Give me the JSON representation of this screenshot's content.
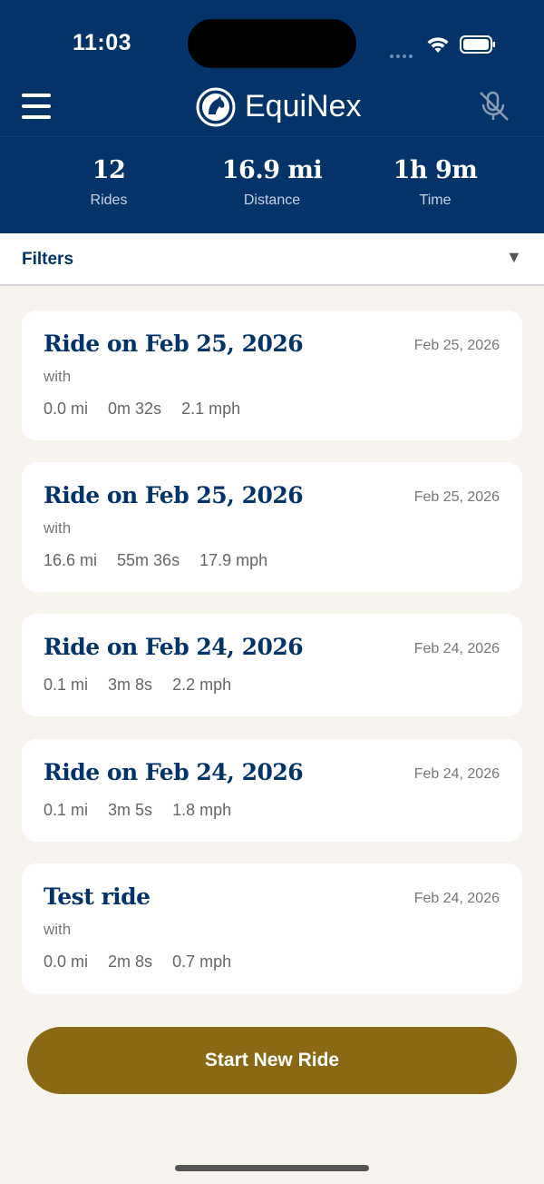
{
  "status_bar": {
    "time": "11:03"
  },
  "header": {
    "app_title": "EquiNex"
  },
  "stats": [
    {
      "value": "12",
      "label": "Rides"
    },
    {
      "value": "16.9 mi",
      "label": "Distance"
    },
    {
      "value": "1h 9m",
      "label": "Time"
    }
  ],
  "filters": {
    "label": "Filters",
    "toggle": "▼"
  },
  "rides": [
    {
      "title": "Ride on Feb 25, 2026",
      "date": "Feb 25, 2026",
      "with": "with",
      "distance": "0.0 mi",
      "duration": "0m 32s",
      "speed": "2.1 mph"
    },
    {
      "title": "Ride on Feb 25, 2026",
      "date": "Feb 25, 2026",
      "with": "with",
      "distance": "16.6 mi",
      "duration": "55m 36s",
      "speed": "17.9 mph"
    },
    {
      "title": "Ride on Feb 24, 2026",
      "date": "Feb 24, 2026",
      "distance": "0.1 mi",
      "duration": "3m 8s",
      "speed": "2.2 mph"
    },
    {
      "title": "Ride on Feb 24, 2026",
      "date": "Feb 24, 2026",
      "distance": "0.1 mi",
      "duration": "3m 5s",
      "speed": "1.8 mph"
    },
    {
      "title": "Test ride",
      "date": "Feb 24, 2026",
      "with": "with",
      "distance": "0.0 mi",
      "duration": "2m 8s",
      "speed": "0.7 mph"
    }
  ],
  "start_button": {
    "label": "Start New Ride"
  },
  "colors": {
    "navy": "#033369",
    "gold": "#8b6914",
    "background": "#f7f4ef"
  },
  "icons": {
    "menu": "hamburger-menu-icon",
    "logo": "horse-head-logo-icon",
    "mic": "mic-off-icon",
    "wifi": "wifi-icon",
    "battery": "battery-icon",
    "dropdown": "triangle-down-icon"
  }
}
